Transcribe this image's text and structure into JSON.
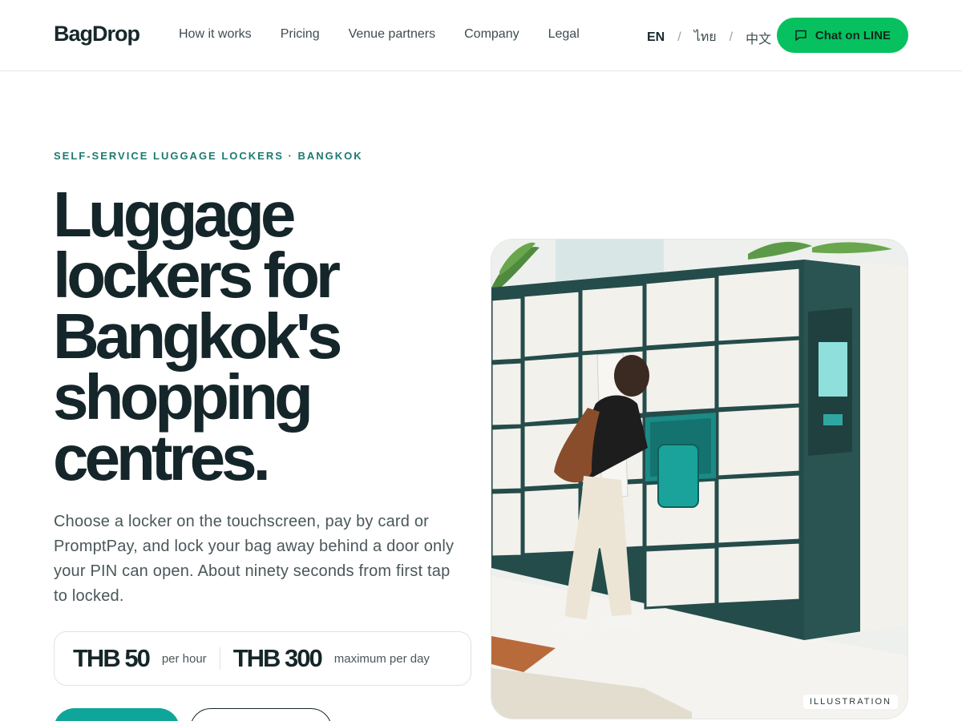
{
  "brand": {
    "name": "BagDrop"
  },
  "nav": {
    "items": [
      {
        "label": "How it works"
      },
      {
        "label": "Pricing"
      },
      {
        "label": "Venue partners"
      },
      {
        "label": "Company"
      },
      {
        "label": "Legal"
      }
    ]
  },
  "languages": {
    "items": [
      {
        "label": "EN",
        "active": true
      },
      {
        "label": "ไทย",
        "active": false
      },
      {
        "label": "中文",
        "active": false
      }
    ],
    "separator": "/"
  },
  "header_cta": {
    "label": "Chat on LINE",
    "icon": "chat-bubble-icon",
    "color": "#07c160"
  },
  "hero": {
    "eyebrow": "SELF-SERVICE LUGGAGE LOCKERS · BANGKOK",
    "headline": "Luggage lockers for Bangkok's shopping centres.",
    "lede": "Choose a locker on the touchscreen, pay by card or PromptPay, and lock your bag away behind a door only your PIN can open. About ninety seconds from first tap to locked.",
    "pricing": [
      {
        "amount": "THB 50",
        "unit": "per hour"
      },
      {
        "amount": "THB 300",
        "unit": "maximum per day"
      }
    ],
    "accent_color": "#0fa59a"
  },
  "illustration": {
    "badge": "ILLUSTRATION"
  }
}
